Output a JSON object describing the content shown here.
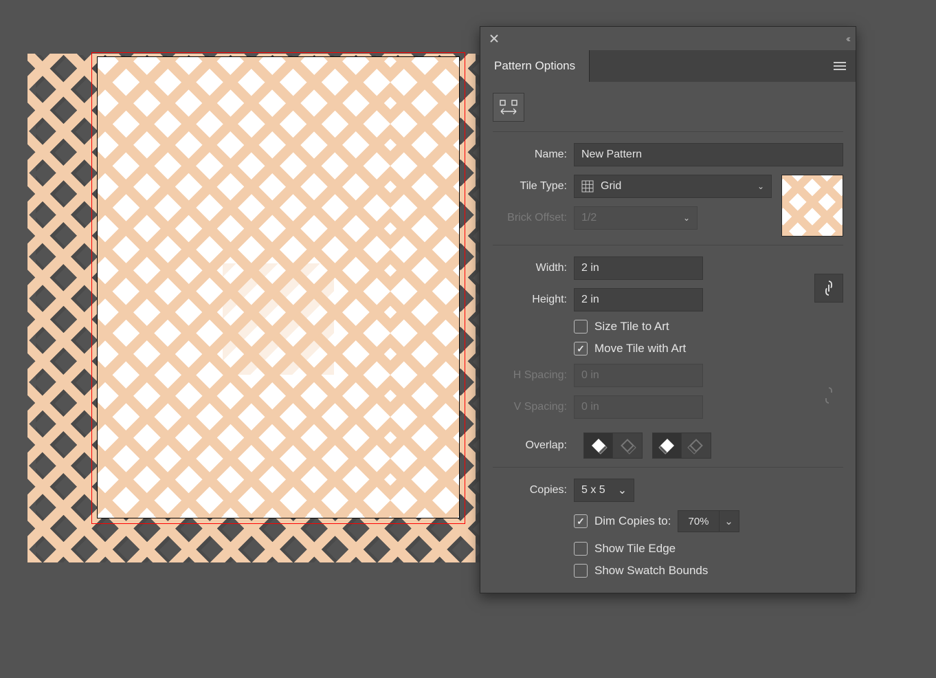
{
  "panel": {
    "title": "Pattern Options",
    "name_label": "Name:",
    "name_value": "New Pattern",
    "tile_type_label": "Tile Type:",
    "tile_type_value": "Grid",
    "brick_offset_label": "Brick Offset:",
    "brick_offset_value": "1/2",
    "width_label": "Width:",
    "width_value": "2 in",
    "height_label": "Height:",
    "height_value": "2 in",
    "size_tile_label": "Size Tile to Art",
    "move_tile_label": "Move Tile with Art",
    "h_spacing_label": "H Spacing:",
    "h_spacing_value": "0 in",
    "v_spacing_label": "V Spacing:",
    "v_spacing_value": "0 in",
    "overlap_label": "Overlap:",
    "copies_label": "Copies:",
    "copies_value": "5 x 5",
    "dim_copies_label": "Dim Copies to:",
    "dim_copies_value": "70%",
    "show_tile_edge_label": "Show Tile Edge",
    "show_swatch_bounds_label": "Show Swatch Bounds"
  },
  "checkboxes": {
    "size_tile": false,
    "move_tile": true,
    "dim_copies": true,
    "show_tile_edge": false,
    "show_swatch_bounds": false
  },
  "colors": {
    "peach": "#f3cdab",
    "panel_bg": "#535353",
    "input_bg": "#424242"
  }
}
